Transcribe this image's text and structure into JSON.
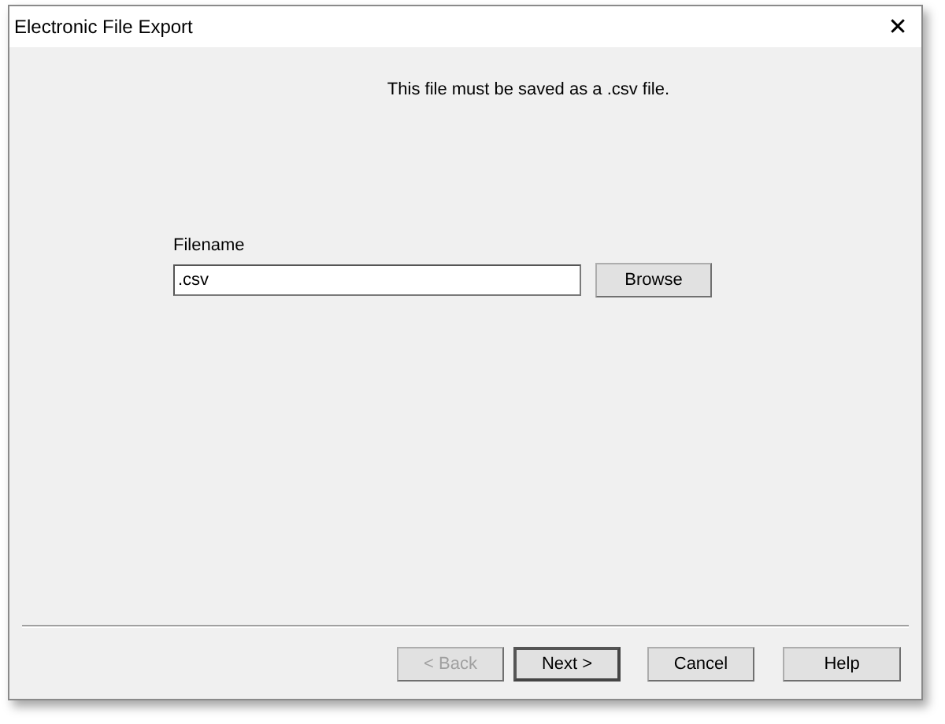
{
  "window": {
    "title": "Electronic File Export",
    "close": "✕"
  },
  "message": "This file must be saved as a .csv file.",
  "filename": {
    "label": "Filename",
    "value": ".csv"
  },
  "browse": {
    "label": "Browse",
    "disabled": false
  },
  "buttons": [
    {
      "label": "< Back",
      "disabled": true,
      "default": false
    },
    {
      "label": "Next >",
      "disabled": false,
      "default": true
    },
    {
      "label": "Cancel",
      "disabled": false,
      "default": false
    },
    {
      "label": "Help",
      "disabled": false,
      "default": false
    }
  ]
}
